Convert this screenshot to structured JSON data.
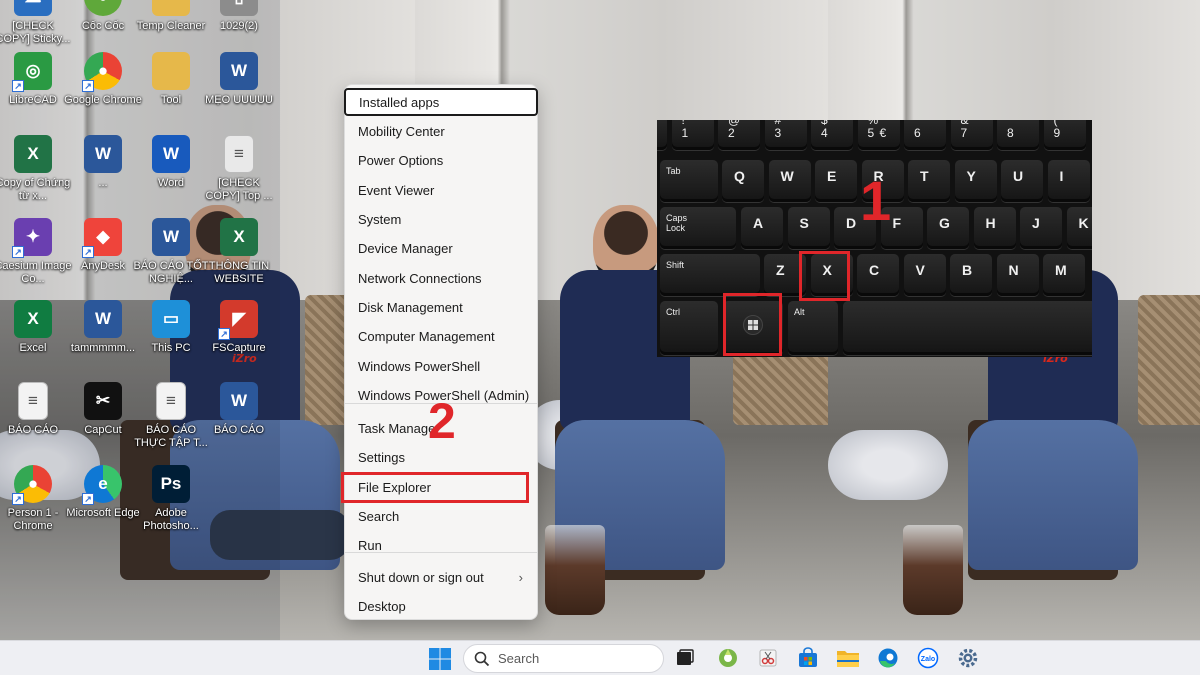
{
  "desktop": {
    "icons": [
      {
        "label": "[CHECK COPY] Sticky...",
        "icon": "cloud-check-icon",
        "color": "#2a6ec0"
      },
      {
        "label": "Cốc Cốc",
        "icon": "coccoc-browser-icon",
        "color": "#5fa83a"
      },
      {
        "label": "Temp Cleaner",
        "icon": "folder-icon",
        "color": "#e6b84a"
      },
      {
        "label": "1029(2)",
        "icon": "file-icon",
        "color": "#8c8c8c"
      },
      {
        "label": "LibreCAD",
        "icon": "librecad-icon",
        "color": "#2a9a43"
      },
      {
        "label": "Google Chrome",
        "icon": "chrome-icon",
        "color": "#4285f4"
      },
      {
        "label": "Tool",
        "icon": "folder-icon",
        "color": "#e6b84a"
      },
      {
        "label": "MẸO UUUUU",
        "icon": "word-doc-icon",
        "color": "#2b579a"
      },
      {
        "label": "Copy of Chứng từ x...",
        "icon": "excel-doc-icon",
        "color": "#217346"
      },
      {
        "label": "...",
        "icon": "word-doc-icon",
        "color": "#2b579a"
      },
      {
        "label": "Word",
        "icon": "word-app-icon",
        "color": "#185abd"
      },
      {
        "label": "[CHECK COPY] Top ...",
        "icon": "text-file-icon",
        "color": "#e9e9e9"
      },
      {
        "label": "Caesium Image Co...",
        "icon": "caesium-icon",
        "color": "#6a3fb0"
      },
      {
        "label": "AnyDesk",
        "icon": "anydesk-icon",
        "color": "#ef443b"
      },
      {
        "label": "BÁO CÁO TỐT NGHIỆ...",
        "icon": "word-doc-icon",
        "color": "#2b579a"
      },
      {
        "label": "THÔNG TIN WEBSITE",
        "icon": "excel-doc-icon",
        "color": "#217346"
      },
      {
        "label": "Excel",
        "icon": "excel-app-icon",
        "color": "#107c41"
      },
      {
        "label": "tammmmm...",
        "icon": "word-doc-icon",
        "color": "#2b579a"
      },
      {
        "label": "This PC",
        "icon": "monitor-icon",
        "color": "#1e90d8"
      },
      {
        "label": "FSCapture",
        "icon": "fscapture-icon",
        "color": "#d33a2c"
      },
      {
        "label": "BÁO CÁO",
        "icon": "pdf-doc-icon",
        "color": "#f3f3f3"
      },
      {
        "label": "CapCut",
        "icon": "capcut-icon",
        "color": "#111111"
      },
      {
        "label": "BÁO CÁO THỰC TẬP T...",
        "icon": "pdf-doc-icon",
        "color": "#f3f3f3"
      },
      {
        "label": "BÁO CÁO",
        "icon": "word-doc-icon",
        "color": "#2b579a"
      },
      {
        "label": "Person 1 - Chrome",
        "icon": "chrome-icon",
        "color": "#4285f4"
      },
      {
        "label": "Microsoft Edge",
        "icon": "edge-icon",
        "color": "#0f78d4"
      },
      {
        "label": "Adobe Photosho...",
        "icon": "photoshop-icon",
        "color": "#001e36"
      }
    ]
  },
  "menu": {
    "items": [
      {
        "label": "Installed apps",
        "focused": true
      },
      {
        "label": "Mobility Center"
      },
      {
        "label": "Power Options"
      },
      {
        "label": "Event Viewer"
      },
      {
        "label": "System"
      },
      {
        "label": "Device Manager"
      },
      {
        "label": "Network Connections"
      },
      {
        "label": "Disk Management"
      },
      {
        "label": "Computer Management"
      },
      {
        "label": "Windows PowerShell"
      },
      {
        "label": "Windows PowerShell (Admin)"
      },
      {
        "label": "Task Manager"
      },
      {
        "label": "Settings"
      },
      {
        "label": "File Explorer",
        "highlighted": true
      },
      {
        "label": "Search"
      },
      {
        "label": "Run"
      },
      {
        "label": "Shut down or sign out",
        "submenu": true
      },
      {
        "label": "Desktop"
      }
    ]
  },
  "keyboard": {
    "number_row": [
      {
        "top": "~",
        "bot": "`"
      },
      {
        "top": "!",
        "bot": "1"
      },
      {
        "top": "@",
        "bot": "2"
      },
      {
        "top": "#",
        "bot": "3"
      },
      {
        "top": "$",
        "bot": "4"
      },
      {
        "top": "%",
        "bot": "5",
        "bot2": "€"
      },
      {
        "top": "^",
        "bot": "6"
      },
      {
        "top": "&",
        "bot": "7"
      },
      {
        "top": "*",
        "bot": "8"
      },
      {
        "top": "(",
        "bot": "9"
      }
    ],
    "row_q": [
      "Tab",
      "Q",
      "W",
      "E",
      "R",
      "T",
      "Y",
      "U",
      "I"
    ],
    "row_a": [
      "Caps Lock",
      "A",
      "S",
      "D",
      "F",
      "G",
      "H",
      "J",
      "K"
    ],
    "row_z": [
      "Shift",
      "Z",
      "X",
      "C",
      "V",
      "B",
      "N",
      "M"
    ],
    "row_bottom": [
      "Ctrl",
      "Alt"
    ],
    "highlighted_keys": [
      "X",
      "Win"
    ]
  },
  "annotations": {
    "step1": "1",
    "step2": "2",
    "highlight_color": "#e0262a"
  },
  "taskbar": {
    "search_placeholder": "Search",
    "apps": [
      {
        "name": "task-view",
        "icon": "task-view-icon"
      },
      {
        "name": "coccoc",
        "icon": "coccoc-browser-icon"
      },
      {
        "name": "snipping",
        "icon": "snipping-tool-icon"
      },
      {
        "name": "store",
        "icon": "microsoft-store-icon"
      },
      {
        "name": "file-explorer",
        "icon": "folder-icon"
      },
      {
        "name": "edge",
        "icon": "edge-icon"
      },
      {
        "name": "zalo",
        "icon": "zalo-icon",
        "label": "Zalo"
      },
      {
        "name": "settings",
        "icon": "gear-icon"
      }
    ]
  }
}
